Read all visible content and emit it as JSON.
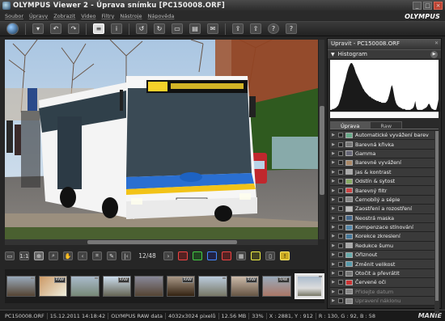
{
  "window": {
    "title": "OLYMPUS Viewer 2 -  Úprava snímku [PC150008.ORF]"
  },
  "menu": [
    "Soubor",
    "Úpravy",
    "Zobrazit",
    "Video",
    "Filtry",
    "Nástroje",
    "Nápověda"
  ],
  "brand": "OLYMPUS",
  "toolbar": {
    "icons": [
      "globe-icon",
      "save-icon",
      "undo-icon",
      "redo-icon",
      "list-icon",
      "info-icon",
      "rotate-left-icon",
      "rotate-right-icon",
      "compare-icon",
      "print-icon",
      "email-icon",
      "share-icon",
      "upload-icon",
      "help-icon",
      "manual-icon"
    ]
  },
  "navigator": {
    "counter": "12/48"
  },
  "filmstrip": {
    "thumbnails": [
      {
        "raw": ""
      },
      {
        "raw": "RAW"
      },
      {
        "raw": ""
      },
      {
        "raw": "RAW"
      },
      {
        "raw": ""
      },
      {
        "raw": "RAW"
      },
      {
        "raw": ""
      },
      {
        "raw": "RAW"
      },
      {
        "raw": "RAW"
      },
      {
        "raw": ""
      }
    ]
  },
  "status": {
    "file": "PC150008.ORF",
    "datetime": "15.12.2011 14:18:42",
    "camera": "OLYMPUS RAW data",
    "dimensions": "4032x3024 pixelů",
    "size": "12.56 MB",
    "zoom": "33%",
    "coords": "X : 2881, Y : 912",
    "rgb": "R : 130, G : 92, B : 58",
    "watermark": "MANIE"
  },
  "panel": {
    "header": "Upravit - PC150008.ORF",
    "histogram_title": "Histogram",
    "tabs": [
      "Úprava",
      "Raw"
    ],
    "items": [
      "Automatické vyvážení barev",
      "Barevná křivka",
      "Gamma",
      "Barevné vyvážení",
      "Jas & kontrast",
      "Odstín & sytost",
      "Barevný filtr",
      "Černobílý a sépie",
      "Zaostření a rozostření",
      "Neostrá maska",
      "Kompenzace stínování",
      "Korekce zkreslení",
      "Redukce šumu",
      "Ořiznout",
      "Změnit velikost",
      "Otočit a převrátit",
      "Červené oči",
      "Přidejte datum",
      "Upravení náklonu"
    ]
  },
  "histogram": [
    2,
    2,
    2,
    3,
    3,
    3,
    4,
    4,
    5,
    6,
    7,
    9,
    12,
    15,
    18,
    22,
    26,
    30,
    33,
    36,
    40,
    44,
    47,
    50,
    52,
    54,
    55,
    55,
    54,
    52,
    50,
    47,
    44,
    42,
    40,
    38,
    36,
    34,
    32,
    30,
    28,
    26,
    25,
    23,
    22,
    21,
    20,
    19,
    18,
    17,
    17,
    16,
    15,
    15,
    14,
    14,
    13,
    13,
    12,
    12,
    12,
    11,
    11,
    11,
    10,
    10,
    10,
    10,
    10,
    10,
    11,
    12,
    14,
    17,
    20,
    24,
    28,
    30,
    27,
    22,
    17,
    13,
    10,
    8,
    7,
    6,
    5,
    5,
    4,
    4,
    3,
    3,
    3,
    3,
    2,
    2,
    2,
    2,
    2,
    2,
    2,
    3,
    3,
    4,
    5,
    8,
    12,
    6,
    3,
    2,
    2,
    2,
    2,
    2,
    2,
    2,
    3,
    3,
    4,
    4,
    5,
    6,
    8,
    9,
    8,
    6,
    4,
    3,
    3,
    2,
    2,
    2,
    2,
    5,
    9,
    14,
    6
  ]
}
